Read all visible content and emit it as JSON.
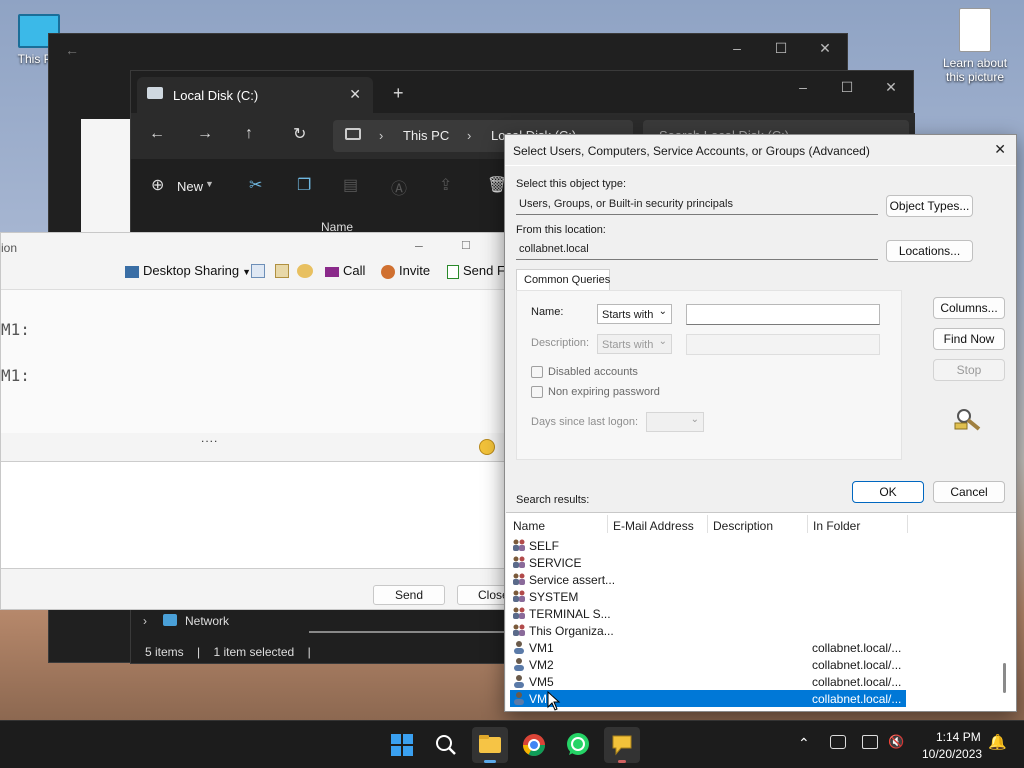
{
  "desktop": {
    "icons": [
      {
        "label": "This PC"
      },
      {
        "label": "Learn about this picture"
      }
    ]
  },
  "explorer": {
    "tab_title": "Local Disk (C:)",
    "new_tab": "+",
    "breadcrumb": [
      "This PC",
      "Local Disk (C:)"
    ],
    "search_placeholder": "Search Local Disk (C:)",
    "new_label": "New",
    "column_name": "Name",
    "sidebar_network": "Network",
    "status_items": "5 items",
    "status_selected": "1 item selected"
  },
  "chat": {
    "title": "ion",
    "toolbar": [
      "Desktop Sharing",
      "Call",
      "Invite",
      "Send Fi"
    ],
    "lines": [
      "M1:",
      "M1:"
    ],
    "splitter": "....",
    "send_label": "Send",
    "close_label": "Close"
  },
  "dialog": {
    "title": "Select Users, Computers, Service Accounts, or Groups (Advanced)",
    "object_type_label": "Select this object type:",
    "object_type_value": "Users, Groups, or Built-in security principals",
    "object_types_button": "Object Types...",
    "location_label": "From this location:",
    "location_value": "collabnet.local",
    "locations_button": "Locations...",
    "tab_common_queries": "Common Queries",
    "name_label": "Name:",
    "name_mode": "Starts with",
    "name_value": "",
    "description_label": "Description:",
    "description_mode": "Starts with",
    "disabled_accounts": "Disabled accounts",
    "non_expiring": "Non expiring password",
    "days_label": "Days since last logon:",
    "columns_button": "Columns...",
    "find_now_button": "Find Now",
    "stop_button": "Stop",
    "ok_button": "OK",
    "cancel_button": "Cancel",
    "results_label": "Search results:",
    "result_columns": [
      "Name",
      "E-Mail Address",
      "Description",
      "In Folder"
    ],
    "rows": [
      {
        "name": "SELF",
        "folder": "",
        "kind": "group"
      },
      {
        "name": "SERVICE",
        "folder": "",
        "kind": "group"
      },
      {
        "name": "Service assert...",
        "folder": "",
        "kind": "group"
      },
      {
        "name": "SYSTEM",
        "folder": "",
        "kind": "group"
      },
      {
        "name": "TERMINAL S...",
        "folder": "",
        "kind": "group"
      },
      {
        "name": "This Organiza...",
        "folder": "",
        "kind": "group"
      },
      {
        "name": "VM1",
        "folder": "collabnet.local/...",
        "kind": "user"
      },
      {
        "name": "VM2",
        "folder": "collabnet.local/...",
        "kind": "user"
      },
      {
        "name": "VM5",
        "folder": "collabnet.local/...",
        "kind": "user"
      },
      {
        "name": "VM6",
        "folder": "collabnet.local/...",
        "kind": "user",
        "selected": true
      }
    ]
  },
  "taskbar": {
    "time": "1:14 PM",
    "date": "10/20/2023"
  },
  "colors": {
    "accent": "#0078d7",
    "taskbar": "#1c1c1c",
    "dark_window": "#202020"
  }
}
